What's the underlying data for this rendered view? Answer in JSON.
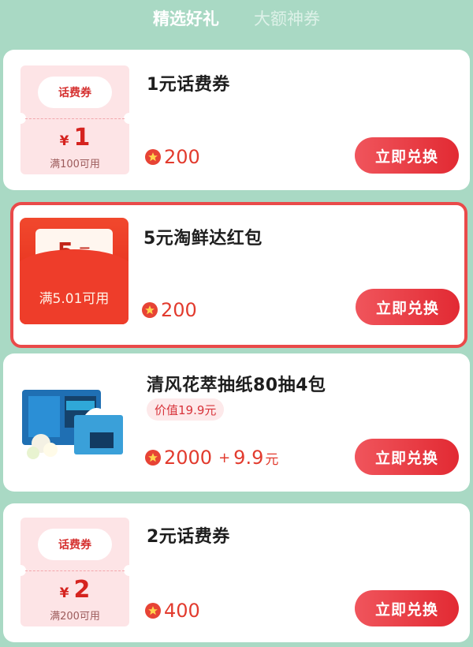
{
  "tabs": [
    {
      "label": "精选好礼",
      "active": true
    },
    {
      "label": "大额神券",
      "active": false
    }
  ],
  "items": [
    {
      "title": "1元话费券",
      "thumb": {
        "type": "coupon",
        "badge": "话费券",
        "currency": "¥",
        "value": "1",
        "condition": "满100可用"
      },
      "points": "200",
      "button": "立即兑换"
    },
    {
      "title": "5元淘鲜达红包",
      "thumb": {
        "type": "red-packet",
        "value": "5",
        "unit": "元",
        "condition": "满5.01可用"
      },
      "points": "200",
      "button": "立即兑换",
      "highlighted": true
    },
    {
      "title": "清风花萃抽纸80抽4包",
      "thumb": {
        "type": "product-image",
        "icon": "tissue-box-icon"
      },
      "tag": "价值19.9元",
      "points": "2000",
      "plus": "+",
      "cash": "9.9",
      "cash_unit": "元",
      "button": "立即兑换"
    },
    {
      "title": "2元话费券",
      "thumb": {
        "type": "coupon",
        "badge": "话费券",
        "currency": "¥",
        "value": "2",
        "condition": "满200可用"
      },
      "points": "400",
      "button": "立即兑换"
    }
  ],
  "colors": {
    "background": "#a9d9c4",
    "accent": "#e22a33",
    "highlight_border": "#ea4a4a"
  }
}
